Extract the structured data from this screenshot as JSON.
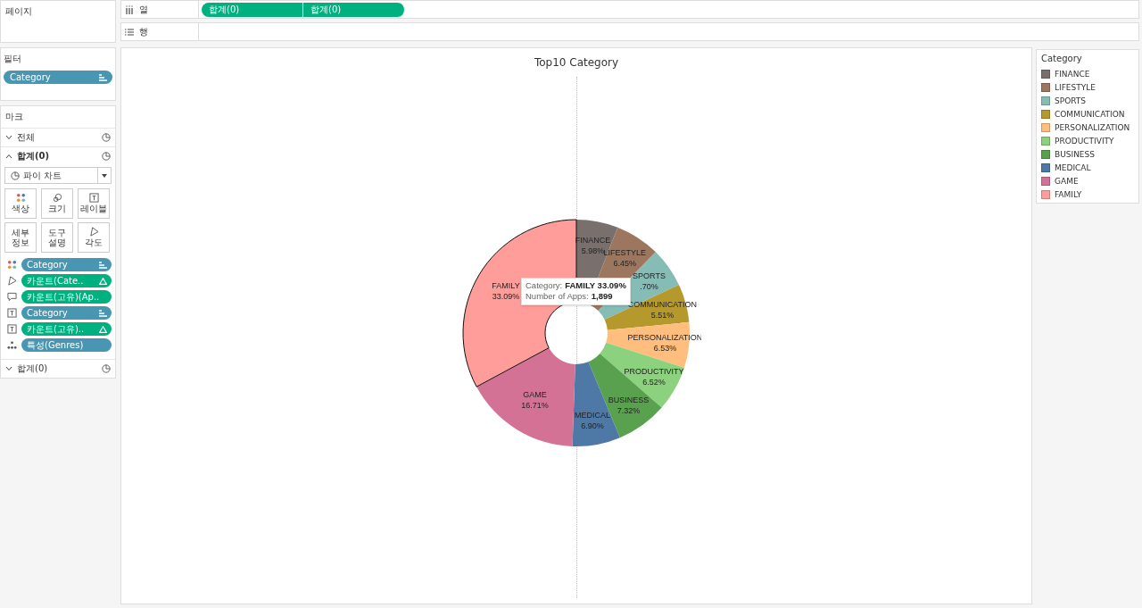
{
  "pages_shelf": {
    "title": "페이지"
  },
  "columns_shelf": {
    "label": "열",
    "pills": [
      "합계(0)",
      "합계(0)"
    ]
  },
  "rows_shelf": {
    "label": "행"
  },
  "filters": {
    "title": "필터",
    "pills": [
      {
        "text": "Category",
        "color": "#4996b2",
        "sorted": true,
        "table_calc": false
      }
    ]
  },
  "marks": {
    "title": "마크",
    "sections": [
      {
        "title": "전체",
        "expanded": false
      },
      {
        "title": "합계(0)",
        "expanded": true
      }
    ],
    "mark_type": "파이 차트",
    "buttons": [
      {
        "label": "색상",
        "kind": "color"
      },
      {
        "label": "크기",
        "kind": "size"
      },
      {
        "label": "레이블",
        "kind": "label"
      },
      {
        "label": "세부 정보",
        "kind": "detail"
      },
      {
        "label": "도구 설명",
        "kind": "tooltip"
      },
      {
        "label": "각도",
        "kind": "angle"
      }
    ],
    "fields": [
      {
        "kind": "color",
        "text": "Category",
        "color": "#4996b2",
        "sorted": true,
        "table_calc": false
      },
      {
        "kind": "angle",
        "text": "카운트(Cate..",
        "color": "#00b180",
        "sorted": false,
        "table_calc": true
      },
      {
        "kind": "tooltip",
        "text": "카운트(고유)(Ap..",
        "color": "#00b180",
        "sorted": false,
        "table_calc": false
      },
      {
        "kind": "label",
        "text": "Category",
        "color": "#4996b2",
        "sorted": true,
        "table_calc": false
      },
      {
        "kind": "label",
        "text": "카운트(고유)..",
        "color": "#00b180",
        "sorted": false,
        "table_calc": true
      },
      {
        "kind": "detail",
        "text": "특성(Genres)",
        "color": "#4996b2",
        "sorted": false,
        "table_calc": false
      }
    ],
    "footer_section": {
      "title": "합계(0)",
      "expanded": false
    }
  },
  "view": {
    "chart_data": {
      "type": "donut",
      "title": "Top10 Category",
      "categories": [
        "FINANCE",
        "LIFESTYLE",
        "SPORTS",
        "COMMUNICATION",
        "PERSONALIZATION",
        "PRODUCTIVITY",
        "BUSINESS",
        "MEDICAL",
        "GAME",
        "FAMILY"
      ],
      "values": [
        5.98,
        6.45,
        5.7,
        5.51,
        6.53,
        6.52,
        7.32,
        6.9,
        16.71,
        33.09
      ],
      "colors": [
        "#79706e",
        "#9d7660",
        "#86bcb6",
        "#b6992d",
        "#ffbe7d",
        "#8cd17d",
        "#59a14f",
        "#4e79a7",
        "#d37295",
        "#ff9d9a"
      ]
    },
    "slices": [
      {
        "percent_text": "5.98%",
        "selected": false
      },
      {
        "percent_text": "6.45%",
        "selected": false
      },
      {
        "percent_text": ".70%",
        "selected": false
      },
      {
        "percent_text": "5.51%",
        "selected": false
      },
      {
        "percent_text": "6.53%",
        "selected": false
      },
      {
        "percent_text": "6.52%",
        "selected": false
      },
      {
        "percent_text": "7.32%",
        "selected": false
      },
      {
        "percent_text": "6.90%",
        "selected": false
      },
      {
        "percent_text": "16.71%",
        "selected": false
      },
      {
        "percent_text": "33.09%",
        "selected": true
      }
    ],
    "tooltip": {
      "line1_label": "Category:",
      "line1_value": "FAMILY 33.09%",
      "line2_label": "Number of Apps:",
      "line2_value": "1,899"
    }
  },
  "legend": {
    "title": "Category",
    "items": [
      {
        "label": "FINANCE",
        "color": "#79706e"
      },
      {
        "label": "LIFESTYLE",
        "color": "#9d7660"
      },
      {
        "label": "SPORTS",
        "color": "#86bcb6"
      },
      {
        "label": "COMMUNICATION",
        "color": "#b6992d"
      },
      {
        "label": "PERSONALIZATION",
        "color": "#ffbe7d"
      },
      {
        "label": "PRODUCTIVITY",
        "color": "#8cd17d"
      },
      {
        "label": "BUSINESS",
        "color": "#59a14f"
      },
      {
        "label": "MEDICAL",
        "color": "#4e79a7"
      },
      {
        "label": "GAME",
        "color": "#d37295"
      },
      {
        "label": "FAMILY",
        "color": "#ff9d9a"
      }
    ]
  }
}
